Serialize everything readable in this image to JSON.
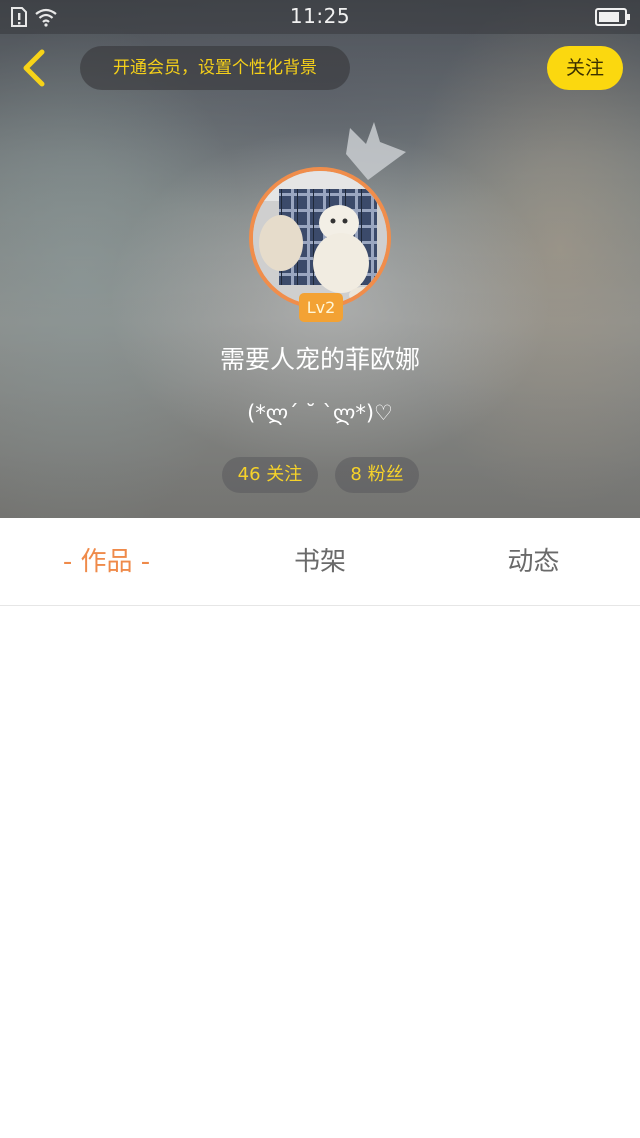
{
  "status_bar": {
    "time": "11:25",
    "icons": [
      "sim-alert-icon",
      "wifi-icon",
      "battery-icon"
    ]
  },
  "header": {
    "back_icon": "chevron-left-icon",
    "vip_prompt": "开通会员，设置个性化背景",
    "follow_label": "关注"
  },
  "profile": {
    "crown_icon": "crown-icon",
    "level": "Lv2",
    "nickname": "需要人宠的菲欧娜",
    "signature": "(*ლ´ ˘ `ლ*)♡",
    "following": "46 关注",
    "fans": "8 粉丝"
  },
  "tabs": [
    {
      "label": "- 作品 -",
      "active": true
    },
    {
      "label": "书架",
      "active": false
    },
    {
      "label": "动态",
      "active": false
    }
  ],
  "colors": {
    "accent_yellow": "#fbd80f",
    "vip_text": "#f5d019",
    "active_tab": "#ef8a4a",
    "avatar_border": "#f08d4b",
    "level_badge": "#f3a234"
  }
}
